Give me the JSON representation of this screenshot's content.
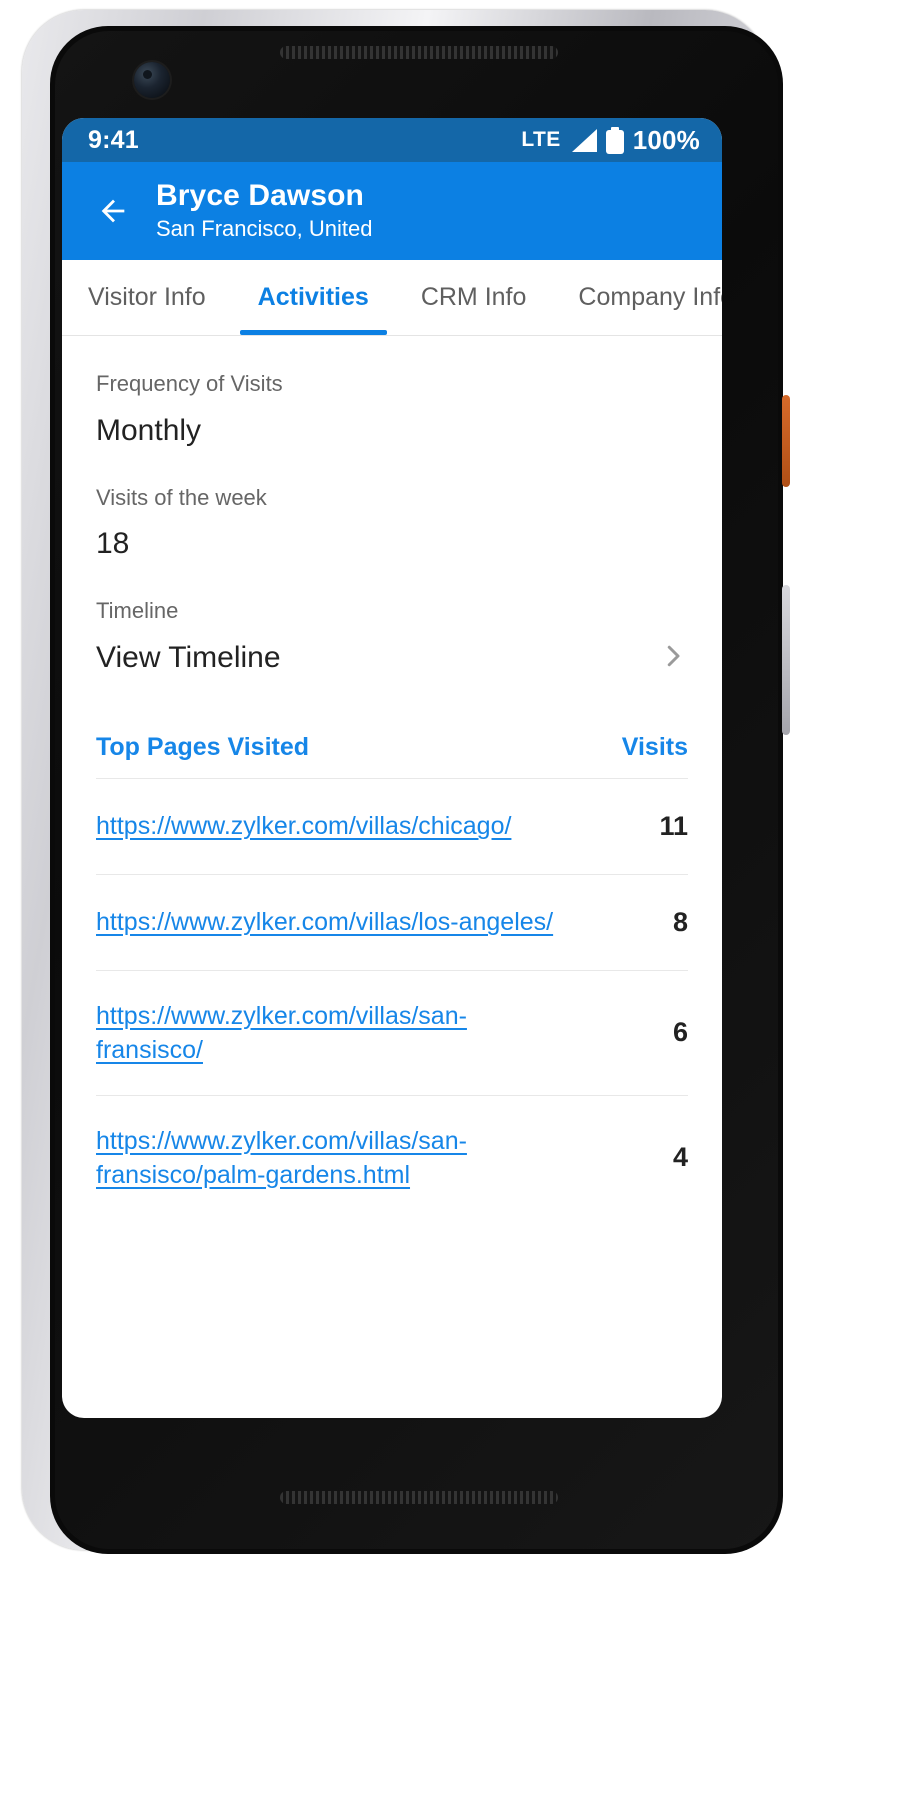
{
  "statusbar": {
    "time": "9:41",
    "network": "LTE",
    "signal_icon": "signal-bars-icon",
    "battery_icon": "battery-full-icon",
    "battery_percent": "100%"
  },
  "appbar": {
    "back_icon": "back-arrow-icon",
    "title": "Bryce Dawson",
    "subtitle": "San Francisco, United"
  },
  "tabs": [
    {
      "label": "Visitor Info",
      "active": false
    },
    {
      "label": "Activities",
      "active": true
    },
    {
      "label": "CRM Info",
      "active": false
    },
    {
      "label": "Company Info",
      "active": false
    }
  ],
  "fields": [
    {
      "label": "Frequency of Visits",
      "value": "Monthly"
    },
    {
      "label": "Visits of the week",
      "value": "18"
    },
    {
      "label": "Timeline",
      "value": "View Timeline",
      "chevron_icon": "chevron-right-icon"
    }
  ],
  "table": {
    "header_pages": "Top Pages Visited",
    "header_visits": "Visits",
    "rows": [
      {
        "url": "https://www.zylker.com/villas/chicago/",
        "visits": "11"
      },
      {
        "url": "https://www.zylker.com/villas/los-angeles/",
        "visits": "8"
      },
      {
        "url": "https://www.zylker.com/villas/san-fransisco/",
        "visits": "6"
      },
      {
        "url": "https://www.zylker.com/villas/san-fransisco/palm-gardens.html",
        "visits": "4"
      }
    ]
  },
  "colors": {
    "appbar_blue": "#0c80e3",
    "statusbar_blue": "#1467a8",
    "link_blue": "#1686e8",
    "tab_inactive": "#5f5f5f",
    "label_gray": "#666666",
    "value_dark": "#222222"
  }
}
